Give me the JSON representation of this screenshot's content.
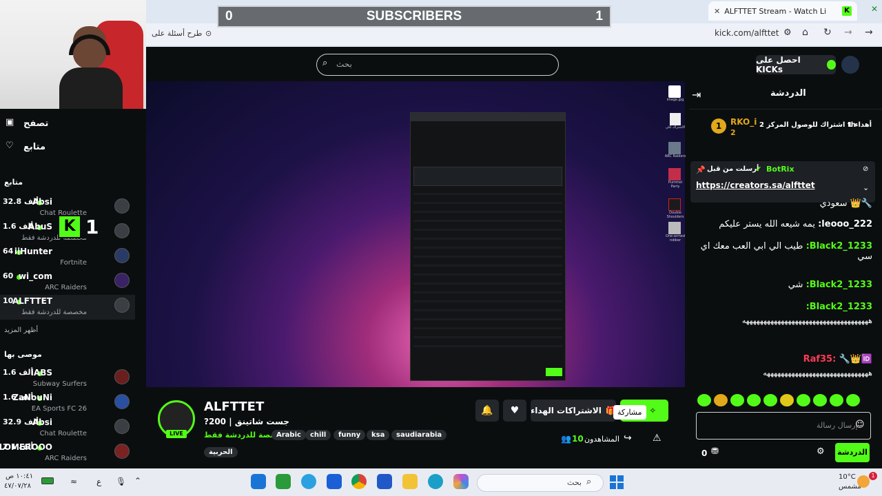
{
  "browser": {
    "tab_title": "ALFTTET Stream - Watch Li",
    "url": "kick.com/alfttet",
    "ask_label": "طرح أسئلة على"
  },
  "banner": {
    "left_count": "0",
    "title": "SUBSCRIBERS",
    "right_count": "1"
  },
  "header": {
    "search_placeholder": "بحث",
    "kicks_label": "احصل على KICKs"
  },
  "sidebar": {
    "browse": "تصفح",
    "following": "متابع",
    "following_heading": "متابع",
    "show_more": "أظهر المزيد",
    "recommended_heading": "موصى بها",
    "items": [
      {
        "name": "Absi",
        "count": "32.8 ألف",
        "game": "Chat Roulette"
      },
      {
        "name": "AbuS",
        "count": "1.6 ألف",
        "game": "مخصصة للدردشة فقط"
      },
      {
        "name": "iiHunter",
        "count": "64",
        "game": "Fortnite"
      },
      {
        "name": "wi_com",
        "count": "60",
        "game": "ARC Raiders"
      },
      {
        "name": "ALFTTET",
        "count": "10",
        "game": "مخصصة للدردشة فقط"
      }
    ],
    "recommended": [
      {
        "name": "iABS",
        "count": "1.6 ألف",
        "game": "Subway Surfers"
      },
      {
        "name": "ZaNouNi",
        "count": "1.6 ألف",
        "game": "EA Sports FC 26"
      },
      {
        "name": "Absi",
        "count": "32.9 ألف",
        "game": "Chat Roulette"
      },
      {
        "name": "LOMEROOO",
        "count": "2.1 ألف",
        "game": "ARC Raiders"
      }
    ],
    "overlay_badge": "1"
  },
  "stream": {
    "channel": "ALFTTET",
    "live": "LIVE",
    "title": "جست شاتينق | 200?",
    "category": "مخصصة للدردشة فقط",
    "tags": [
      "Arabic",
      "chill",
      "funny",
      "ksa",
      "saudiarabia"
    ],
    "extra_tag": "الحربية",
    "viewers": "10",
    "viewers_label": "المشاهدون",
    "gift_subs": "الاشتراكات الهداء",
    "share_tooltip": "مشاركة",
    "follow_partial": "اش"
  },
  "desktop_icons": [
    "image.jpg",
    "الاشتراك لكي",
    "ARC Raiders",
    "Pummel Party",
    "Double Shoulders",
    "One-armed robber"
  ],
  "chat": {
    "title": "الدردشة",
    "gifter": {
      "name": "RKO_i",
      "rank": "1",
      "text": "أهداء 1 اشتراك للوصول المركز 2",
      "count": "2",
      "suffix": "th"
    },
    "pinned": {
      "label": "أرسلت من قبل",
      "user": "BotRix",
      "link": "https://creators.sa/alfttet"
    },
    "messages": [
      {
        "user": "",
        "text": "سعودي"
      },
      {
        "user": "leooo_222:",
        "text": "يمه شيعه الله يستر عليكم"
      },
      {
        "user": "Black2_1233:",
        "text": "طيب الي ابي العب معك اي سي"
      },
      {
        "user": "Black2_1233:",
        "text": "شي"
      },
      {
        "user": "Black2_1233:",
        "text": "ههههههههههههههههههههههههههههههههههههه"
      },
      {
        "user": "Raf35:",
        "text": "ههههههههههههههههههههههههههههههه"
      }
    ],
    "input_placeholder": "إرسال رسالة",
    "send_label": "الدردشة",
    "points": "0"
  },
  "taskbar": {
    "search_placeholder": "بحث",
    "weather_temp": "10°C",
    "weather_desc": "مشمس",
    "time": "١٠:٤١ ص",
    "date": "٤٧/٠٧/٢٨",
    "lang": "ع",
    "weather_badge": "1"
  },
  "colors": {
    "kick_green": "#53fc18",
    "chat_red": "#ff3b55",
    "banner_gray": "#676b70"
  }
}
